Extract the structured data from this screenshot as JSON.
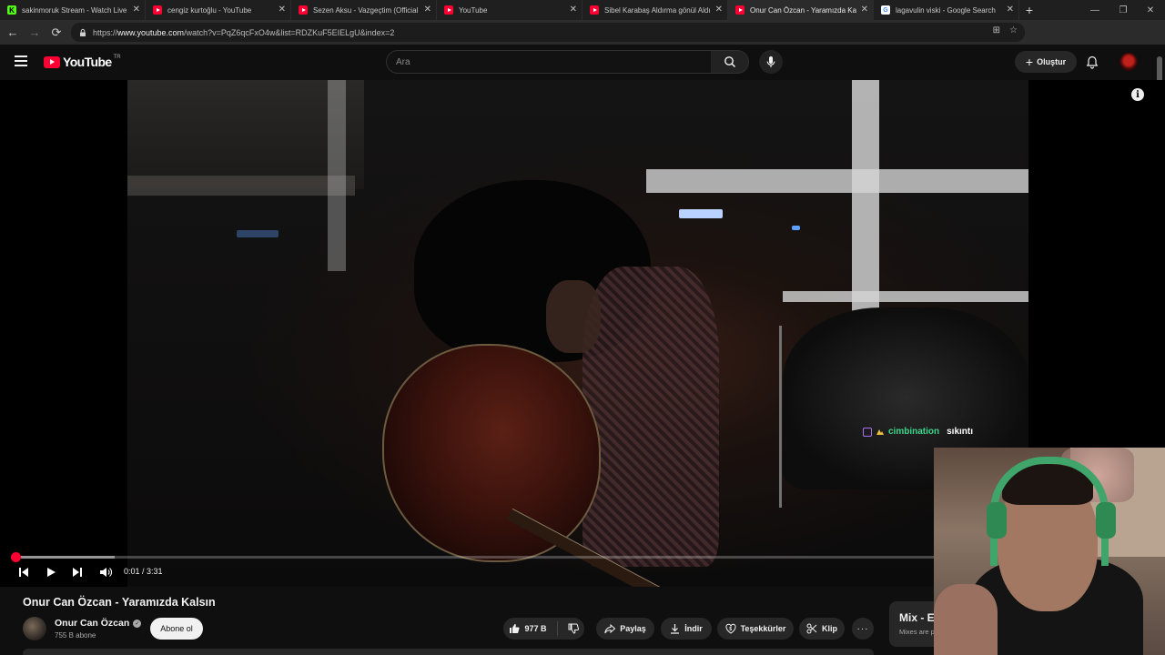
{
  "browser": {
    "tabs": [
      {
        "title": "sakinmoruk Stream - Watch Live",
        "favicon": "kick-favicon"
      },
      {
        "title": "cengiz kurtoğlu - YouTube",
        "favicon": "youtube-favicon"
      },
      {
        "title": "Sezen Aksu - Vazgeçtim (Official",
        "favicon": "youtube-favicon"
      },
      {
        "title": "YouTube",
        "favicon": "youtube-favicon"
      },
      {
        "title": "Sibel Karabaş Aldırma gönül Aldır",
        "favicon": "youtube-favicon"
      },
      {
        "title": "Onur Can Özcan - Yaramızda Kalsı",
        "favicon": "youtube-favicon",
        "active": true
      },
      {
        "title": "lagavulin viski - Google Search",
        "favicon": "google-favicon"
      }
    ],
    "new_tab": "+",
    "url_prefix": "https://",
    "url_host": "www.youtube.com",
    "url_path": "/watch?v=PqZ6qcFxO4w&list=RDZKuF5EIELgU&index=2"
  },
  "masthead": {
    "logo_text": "YouTube",
    "country_code": "TR",
    "search_placeholder": "Ara",
    "create_label": "Oluştur"
  },
  "player": {
    "time_current": "0:01",
    "time_separator": " / ",
    "time_total": "3:31",
    "played_fraction": 0.005,
    "loaded_fraction": 0.112
  },
  "chat_overlay": {
    "username": "cimbination",
    "message": "sıkıntı",
    "username_color": "#3dd68c"
  },
  "video": {
    "title": "Onur Can Özcan - Yaramızda Kalsın",
    "channel_name": "Onur Can Özcan",
    "subscribers": "755 B abone",
    "subscribe_label": "Abone ol",
    "likes": "977 B",
    "share_label": "Paylaş",
    "download_label": "İndir",
    "thanks_label": "Teşekkürler",
    "clip_label": "Klip",
    "more_label": "···"
  },
  "sidebar_mix": {
    "title": "Mix - E",
    "subtitle": "Mixes are p"
  },
  "colors": {
    "youtube_red": "#ff0033",
    "background": "#0f0f0f",
    "pill_bg": "#272727"
  }
}
